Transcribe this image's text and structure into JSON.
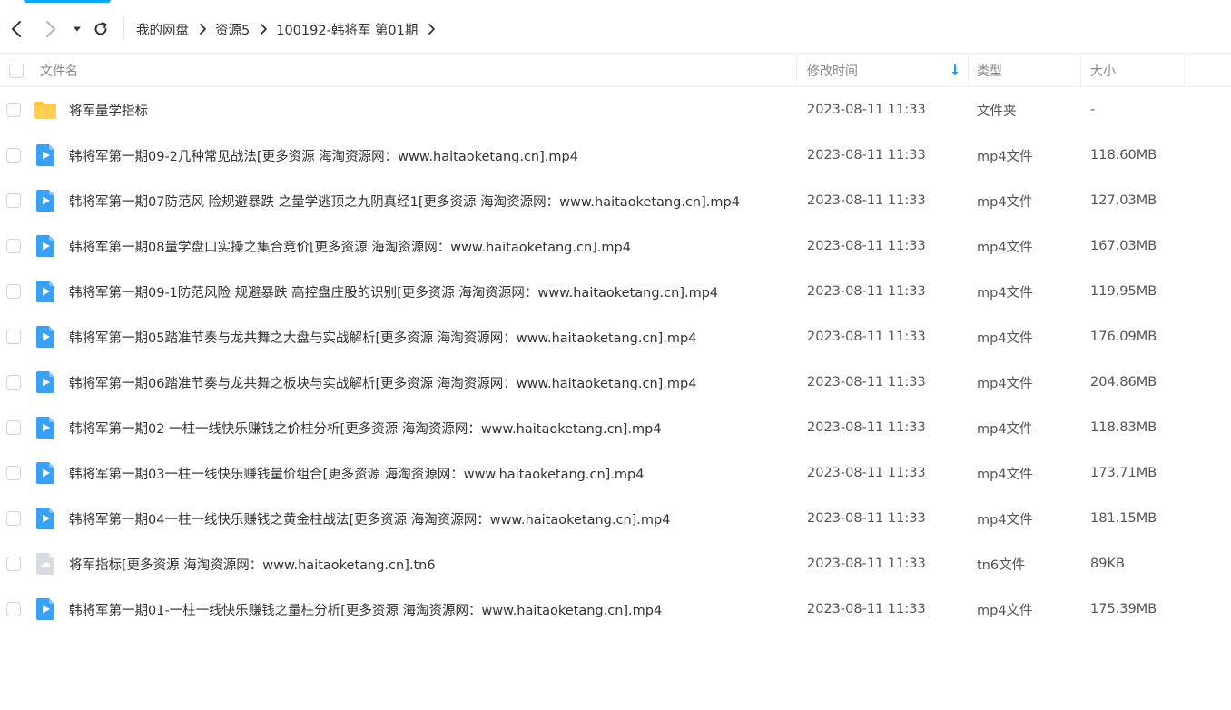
{
  "nav": {
    "breadcrumb": [
      "我的网盘",
      "资源5",
      "100192-韩将军 第01期"
    ]
  },
  "header": {
    "name": "文件名",
    "time": "修改时间",
    "type": "类型",
    "size": "大小"
  },
  "colors": {
    "accent": "#06a7ff",
    "folder": "#ffc63d",
    "video": "#3aa0f5",
    "generic": "#d8dce2"
  },
  "files": [
    {
      "icon": "folder-icon",
      "name": "将军量学指标",
      "time": "2023-08-11 11:33",
      "type": "文件夹",
      "size": "-"
    },
    {
      "icon": "video-file-icon",
      "name": "韩将军第一期09-2几种常见战法[更多资源 海淘资源网：www.haitaoketang.cn].mp4",
      "time": "2023-08-11 11:33",
      "type": "mp4文件",
      "size": "118.60MB"
    },
    {
      "icon": "video-file-icon",
      "name": "韩将军第一期07防范风 险规避暴跌 之量学逃顶之九阴真经1[更多资源 海淘资源网：www.haitaoketang.cn].mp4",
      "time": "2023-08-11 11:33",
      "type": "mp4文件",
      "size": "127.03MB"
    },
    {
      "icon": "video-file-icon",
      "name": "韩将军第一期08量学盘口实操之集合竞价[更多资源 海淘资源网：www.haitaoketang.cn].mp4",
      "time": "2023-08-11 11:33",
      "type": "mp4文件",
      "size": "167.03MB"
    },
    {
      "icon": "video-file-icon",
      "name": "韩将军第一期09-1防范风险 规避暴跌 高控盘庄股的识别[更多资源 海淘资源网：www.haitaoketang.cn].mp4",
      "time": "2023-08-11 11:33",
      "type": "mp4文件",
      "size": "119.95MB"
    },
    {
      "icon": "video-file-icon",
      "name": "韩将军第一期05踏准节奏与龙共舞之大盘与实战解析[更多资源 海淘资源网：www.haitaoketang.cn].mp4",
      "time": "2023-08-11 11:33",
      "type": "mp4文件",
      "size": "176.09MB"
    },
    {
      "icon": "video-file-icon",
      "name": "韩将军第一期06踏准节奏与龙共舞之板块与实战解析[更多资源 海淘资源网：www.haitaoketang.cn].mp4",
      "time": "2023-08-11 11:33",
      "type": "mp4文件",
      "size": "204.86MB"
    },
    {
      "icon": "video-file-icon",
      "name": "韩将军第一期02 一柱一线快乐赚钱之价柱分析[更多资源 海淘资源网：www.haitaoketang.cn].mp4",
      "time": "2023-08-11 11:33",
      "type": "mp4文件",
      "size": "118.83MB"
    },
    {
      "icon": "video-file-icon",
      "name": "韩将军第一期03一柱一线快乐赚钱量价组合[更多资源 海淘资源网：www.haitaoketang.cn].mp4",
      "time": "2023-08-11 11:33",
      "type": "mp4文件",
      "size": "173.71MB"
    },
    {
      "icon": "video-file-icon",
      "name": "韩将军第一期04一柱一线快乐赚钱之黄金柱战法[更多资源 海淘资源网：www.haitaoketang.cn].mp4",
      "time": "2023-08-11 11:33",
      "type": "mp4文件",
      "size": "181.15MB"
    },
    {
      "icon": "generic-file-icon",
      "name": "将军指标[更多资源 海淘资源网：www.haitaoketang.cn].tn6",
      "time": "2023-08-11 11:33",
      "type": "tn6文件",
      "size": "89KB"
    },
    {
      "icon": "video-file-icon",
      "name": "韩将军第一期01-一柱一线快乐赚钱之量柱分析[更多资源 海淘资源网：www.haitaoketang.cn].mp4",
      "time": "2023-08-11 11:33",
      "type": "mp4文件",
      "size": "175.39MB"
    }
  ]
}
